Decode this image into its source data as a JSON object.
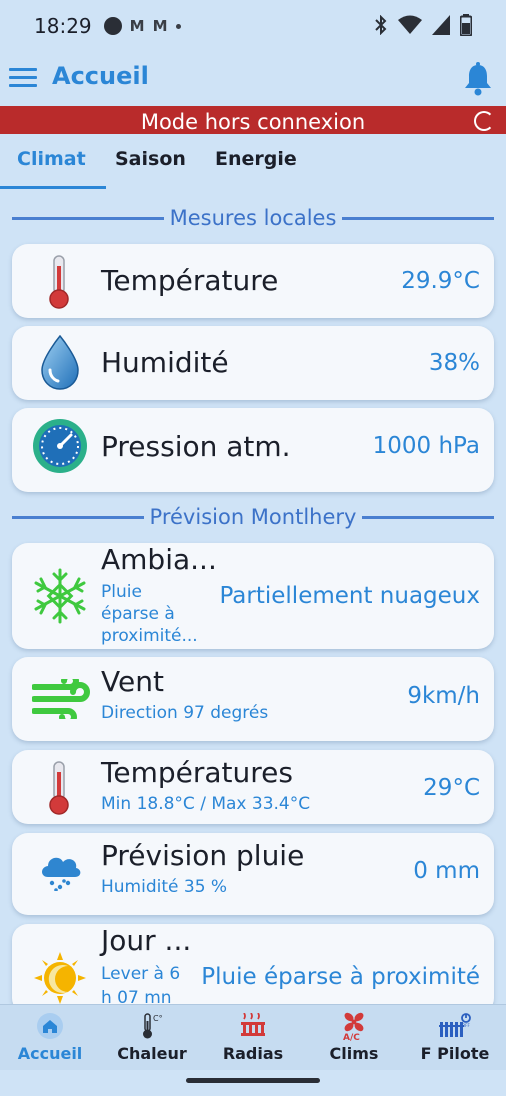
{
  "status_bar": {
    "time": "18:29",
    "mail_1": "M",
    "mail_2": "M",
    "icons": [
      "bluetooth-icon",
      "wifi-icon",
      "signal-icon",
      "battery-icon"
    ]
  },
  "app_bar": {
    "title": "Accueil",
    "menu_icon": "menu-icon",
    "bell_icon": "bell-icon"
  },
  "offline_banner": {
    "text": "Mode hors connexion",
    "spinner_icon": "spinner-icon"
  },
  "tabs": [
    {
      "label": "Climat",
      "active": true
    },
    {
      "label": "Saison",
      "active": false
    },
    {
      "label": "Energie",
      "active": false
    }
  ],
  "local_section": {
    "title": "Mesures locales",
    "cards": [
      {
        "label": "Température",
        "value": "29.9°C",
        "icon": "thermometer-icon"
      },
      {
        "label": "Humidité",
        "value": "38%",
        "icon": "water-drop-icon"
      },
      {
        "label": "Pression atm.",
        "value": "1000 hPa",
        "icon": "pressure-gauge-icon"
      }
    ]
  },
  "forecast_section": {
    "title": "Prévision Montlhery",
    "cards": [
      {
        "label": "Ambia...",
        "sub": "Pluie éparse à proximité...",
        "sub_lines": [
          "Pluie",
          "éparse à",
          "proximité..."
        ],
        "value": "Partiellement nuageux",
        "icon": "snowflake-icon"
      },
      {
        "label": "Vent",
        "sub": "Direction 97 degrés",
        "value": "9km/h",
        "icon": "wind-icon"
      },
      {
        "label": "Températures",
        "sub": "Min 18.8°C / Max 33.4°C",
        "value": "29°C",
        "icon": "thermometer-icon"
      },
      {
        "label": "Prévision pluie",
        "sub": "Humidité 35 %",
        "value": "0 mm",
        "icon": "rain-cloud-icon"
      },
      {
        "label": "Jour ...",
        "sub": "Lever à 6 h 07 mn",
        "sub_lines": [
          "Lever à 6",
          "h 07 mn"
        ],
        "value": "Pluie éparse à proximité",
        "icon": "sun-moon-icon"
      }
    ]
  },
  "bottom_nav": [
    {
      "label": "Accueil",
      "icon": "home-icon",
      "active": true
    },
    {
      "label": "Chaleur",
      "icon": "thermometer-celsius-icon",
      "active": false
    },
    {
      "label": "Radias",
      "icon": "radiator-icon",
      "active": false
    },
    {
      "label": "Clims",
      "icon": "ac-fan-icon",
      "active": false
    },
    {
      "label": "F Pilote",
      "icon": "pilot-wire-icon",
      "active": false
    }
  ],
  "colors": {
    "background": "#cfe3f6",
    "accent": "#2b86d6",
    "banner": "#b92b2b",
    "section_line": "#4a7fd0",
    "card": "#f5f8fc"
  }
}
